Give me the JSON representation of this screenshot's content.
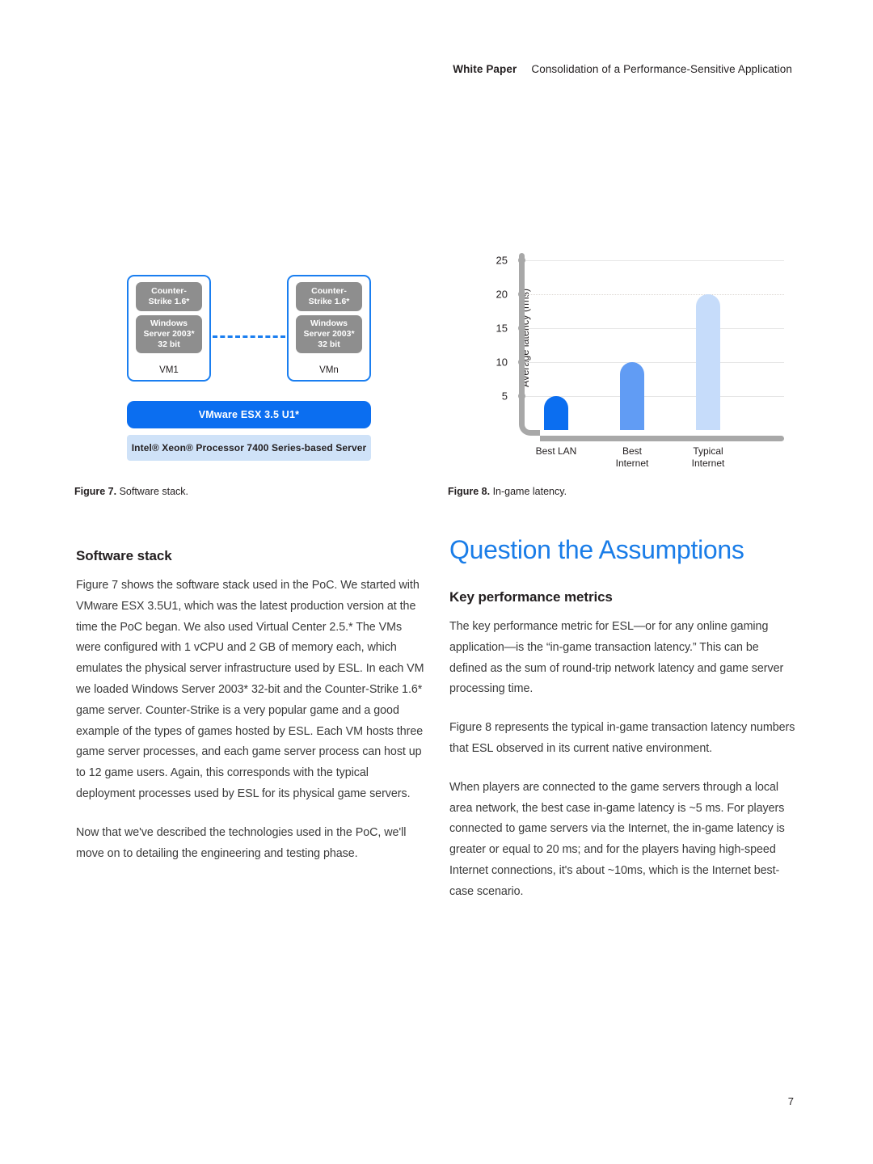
{
  "header": {
    "label": "White Paper",
    "title": "Consolidation of a Performance-Sensitive Application"
  },
  "figure7": {
    "caption_lead": "Figure 7.",
    "caption_text": " Software stack.",
    "vm_left": {
      "game_line1": "Counter-",
      "game_line2": "Strike 1.6*",
      "os_line1": "Windows",
      "os_line2": "Server 2003*",
      "os_line3": "32 bit",
      "label": "VM1"
    },
    "vm_right": {
      "game_line1": "Counter-",
      "game_line2": "Strike 1.6*",
      "os_line1": "Windows",
      "os_line2": "Server 2003*",
      "os_line3": "32 bit",
      "label": "VMn"
    },
    "hypervisor_label": "VMware ESX 3.5 U1*",
    "hardware_label": "Intel® Xeon® Processor 7400 Series-based Server",
    "colors": {
      "vm_border": "#1a7ef0",
      "process_box": "#8e8e8e",
      "hypervisor": "#0b6ef0",
      "hardware": "#cfe2f8"
    }
  },
  "figure8": {
    "caption_lead": "Figure 8.",
    "caption_text": " In-game latency."
  },
  "chart_data": {
    "type": "bar",
    "title": "",
    "xlabel": "",
    "ylabel": "Average latency (rms)",
    "categories": [
      "Best LAN",
      "Best Internet",
      "Typical Internet"
    ],
    "category_lines": [
      [
        "Best LAN",
        ""
      ],
      [
        "Best",
        "Internet"
      ],
      [
        "Typical",
        "Internet"
      ]
    ],
    "values": [
      5,
      10,
      20
    ],
    "ylim": [
      0,
      27
    ],
    "yticks": [
      5,
      10,
      15,
      20,
      25
    ],
    "grid": true,
    "legend": "none",
    "bar_colors": [
      "#0b6ef0",
      "#619cf4",
      "#c6dcfa"
    ]
  },
  "left_column": {
    "heading": "Software stack",
    "paragraphs": [
      "Figure 7 shows the software stack used in the PoC. We started with VMware ESX 3.5U1, which was the latest production version at the time the PoC began. We also used Virtual Center 2.5.* The VMs were configured with 1 vCPU and 2 GB of memory each, which emulates the physical server infrastructure used by ESL. In each VM we loaded Windows Server 2003* 32-bit and the Counter-Strike 1.6* game server. Counter-Strike is a very popular game and a good example of the types of games hosted by ESL. Each VM hosts three game server processes, and each game server process can host up to 12 game users. Again, this corresponds with the typical deployment processes used by ESL for its physical game servers.",
      "Now that we've described the technologies used in the PoC, we'll move on to detailing the engineering and testing phase."
    ]
  },
  "right_column": {
    "title": "Question the Assumptions",
    "heading": "Key performance metrics",
    "paragraphs": [
      "The key performance metric for ESL—or for any online gaming application—is the “in-game transaction latency.” This can be defined as the sum of round-trip network latency and game server processing time.",
      "Figure 8 represents the typical in-game transaction latency numbers that ESL observed in its current native environment.",
      "When players are connected to the game servers through a local area network, the best case in-game latency is ~5 ms. For players connected to game servers via the Internet, the in-game latency is greater or equal to 20 ms; and for the players having high-speed Internet connections, it's about ~10ms, which is the Internet best-case scenario."
    ]
  },
  "footer": {
    "page_number": "7"
  }
}
